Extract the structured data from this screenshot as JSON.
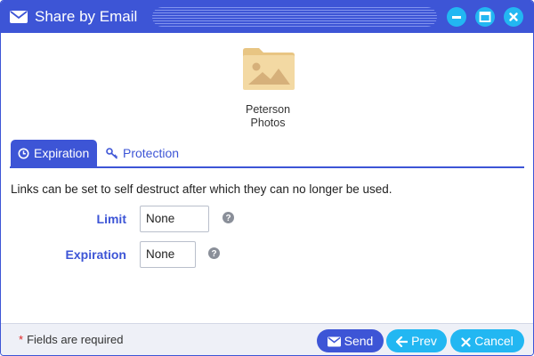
{
  "window": {
    "title": "Share by Email",
    "buttons": {
      "minimize_icon": "minimize-icon",
      "maximize_icon": "maximize-icon",
      "close_icon": "close-icon"
    }
  },
  "item": {
    "icon": "folder-image-icon",
    "name_line1": "Peterson",
    "name_line2": "Photos"
  },
  "tabs": [
    {
      "label": "Expiration",
      "icon": "clock-icon",
      "active": true
    },
    {
      "label": "Protection",
      "icon": "key-icon",
      "active": false
    }
  ],
  "expiration": {
    "description": "Links can be set to self destruct after which they can no longer be used.",
    "limit_label": "Limit",
    "limit_value": "None",
    "expiration_label": "Expiration",
    "expiration_value": "None",
    "help_icon": "question-circle-icon"
  },
  "footer": {
    "required_star": "*",
    "required_note": "Fields are required",
    "send_label": "Send",
    "prev_label": "Prev",
    "cancel_label": "Cancel"
  },
  "colors": {
    "primary": "#3d55d6",
    "accent": "#22b7f2",
    "required": "#e02424"
  }
}
